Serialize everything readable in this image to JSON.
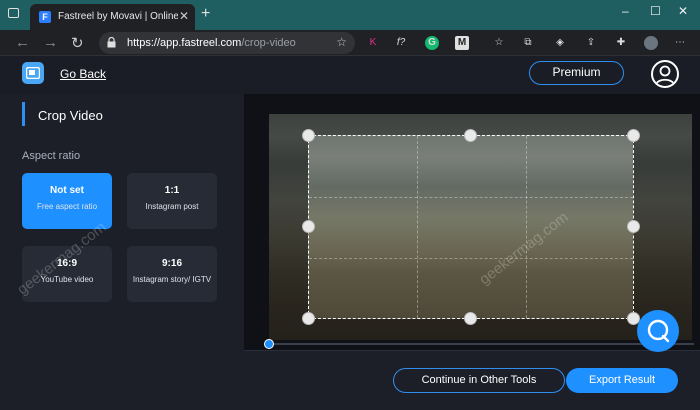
{
  "browser": {
    "tab_title": "Fastreel by Movavi | Online Video",
    "favicon_letter": "F",
    "url_host": "https://app.fastreel.com",
    "url_path": "/crop-video",
    "extensions": [
      "K",
      "f?",
      "G",
      "M"
    ]
  },
  "header": {
    "go_back": "Go Back",
    "premium": "Premium"
  },
  "sidebar": {
    "title": "Crop Video",
    "section": "Aspect ratio",
    "ratios": [
      {
        "value": "Not set",
        "desc": "Free aspect ratio",
        "active": true
      },
      {
        "value": "1:1",
        "desc": "Instagram post",
        "active": false
      },
      {
        "value": "16:9",
        "desc": "YouTube video",
        "active": false
      },
      {
        "value": "9:16",
        "desc": "Instagram story/ IGTV",
        "active": false
      }
    ]
  },
  "footer": {
    "continue": "Continue in Other Tools",
    "export": "Export Result"
  },
  "watermark": "geekermag.com",
  "colors": {
    "accent": "#1e90ff",
    "background": "#1c1f28",
    "browser_frame": "#1f5f62"
  }
}
